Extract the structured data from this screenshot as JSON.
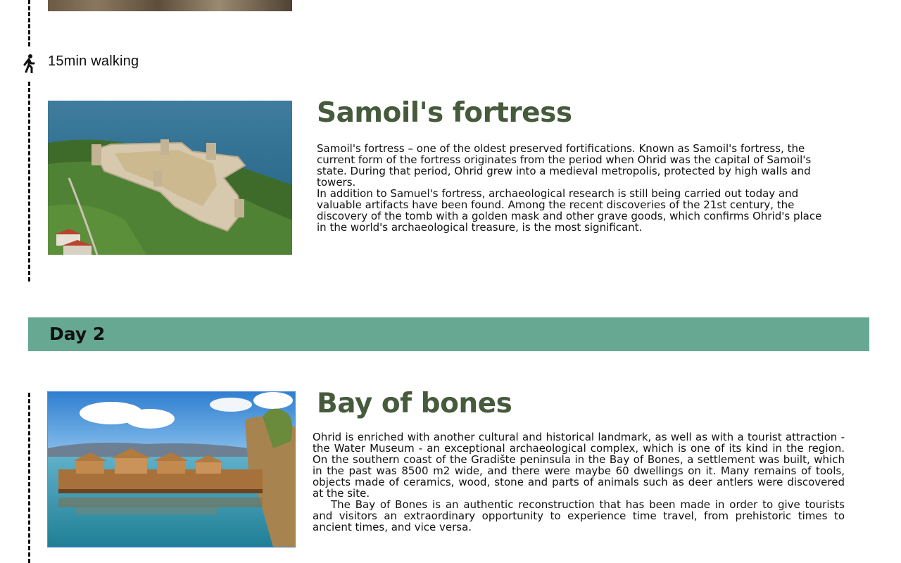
{
  "walk": {
    "label": "15min walking",
    "icon": "walking-person-icon"
  },
  "sections": {
    "fortress": {
      "title": "Samoil's fortress",
      "paragraphs": [
        "Samoil's fortress – one of the oldest preserved fortifications. Known as Samoil's fortress, the current form of the fortress originates from the period when Ohrid was the capital of Samoil's state. During that period, Ohrid grew into a medieval metropolis, protected by high walls and towers.",
        "In addition to Samuel's fortress, archaeological research is still being carried out today and valuable artifacts have been found. Among the recent discoveries of the 21st century, the discovery of the tomb with a golden mask and other grave goods, which confirms Ohrid's place in the world's archaeological treasure, is the most significant."
      ]
    },
    "day": {
      "label": "Day 2"
    },
    "bay": {
      "title": "Bay of bones",
      "paragraphs": [
        "Ohrid is enriched with another cultural and historical landmark, as well as with a tourist attraction - the Water Museum - an exceptional archaeological complex, which is one of its kind in the region. On the southern coast of the Gradište peninsula in the Bay of Bones, a settlement was built, which in the past was 8500 m2 wide, and there were maybe 60 dwellings on it. Many remains of tools, objects made of ceramics, wood, stone and parts of animals such as deer antlers were discovered at the site.",
        "The Bay of Bones is an authentic reconstruction that has been made in order to give tourists and visitors an extraordinary opportunity to experience time travel, from prehistoric times to ancient times, and vice versa."
      ]
    }
  },
  "colors": {
    "title": "#465a3c",
    "banner": "#67a892",
    "timeline": "#111111"
  }
}
